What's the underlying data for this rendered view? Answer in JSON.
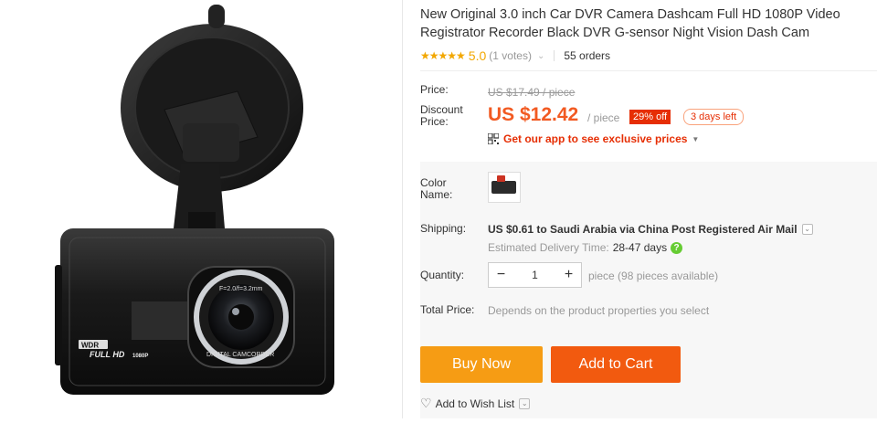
{
  "product": {
    "title": "New Original 3.0 inch Car DVR Camera Dashcam Full HD 1080P Video Registrator Recorder Black DVR G-sensor Night Vision Dash Cam",
    "image_alt": "Car DVR dashcam with suction mount",
    "image_text": {
      "wdr": "WDR",
      "fullhd": "FULL HD",
      "res": "1080P",
      "lens_ring": "F=2.0/f=3.2mm",
      "lens_label": "DIGITAL CAMCORDER"
    }
  },
  "rating": {
    "stars": "★★★★★",
    "value": "5.0",
    "votes": "(1 votes)",
    "orders": "55 orders"
  },
  "pricing": {
    "price_label": "Price:",
    "old_price": "US $17.49 / piece",
    "discount_label": "Discount Price:",
    "price": "US $12.42",
    "per": "/ piece",
    "off": "29% off",
    "days_left": "3 days left",
    "app_promo": "Get our app to see exclusive prices"
  },
  "options": {
    "color_label": "Color Name:",
    "shipping_label": "Shipping:",
    "shipping_cost": "US $0.61",
    "shipping_to": "to Saudi Arabia via China Post Registered Air Mail",
    "est_label": "Estimated Delivery Time:",
    "est_days": "28-47 days",
    "help": "?",
    "quantity_label": "Quantity:",
    "quantity": "1",
    "minus": "−",
    "plus": "+",
    "availability": "piece (98 pieces available)",
    "total_label": "Total Price:",
    "total_value": "Depends on the product properties you select"
  },
  "actions": {
    "buy_now": "Buy Now",
    "add_to_cart": "Add to Cart",
    "wishlist": "Add to Wish List"
  },
  "colors": {
    "accent": "#f25a22",
    "buy": "#f69c14",
    "cart": "#f25a0f",
    "star": "#f2a700",
    "promo": "#e62e04"
  }
}
